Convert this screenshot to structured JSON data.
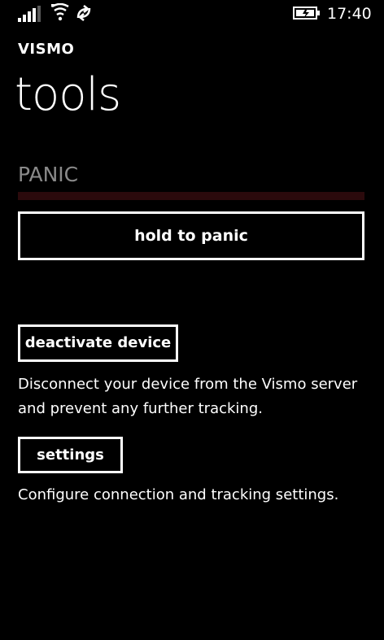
{
  "status_bar": {
    "time": "17:40",
    "icons": [
      "signal-icon",
      "wifi-icon",
      "data-sync-icon",
      "battery-charging-icon"
    ]
  },
  "app": {
    "name": "VISMO",
    "page_title": "tools"
  },
  "panic": {
    "section_label": "PANIC",
    "progress": 0,
    "progress_color": "#c1121f",
    "track_color": "#2b0a0c",
    "button_label": "hold to panic"
  },
  "deactivate": {
    "button_label": "deactivate device",
    "description": "Disconnect your device from the Vismo server and prevent any further tracking."
  },
  "settings": {
    "button_label": "settings",
    "description": "Configure connection and tracking settings."
  }
}
